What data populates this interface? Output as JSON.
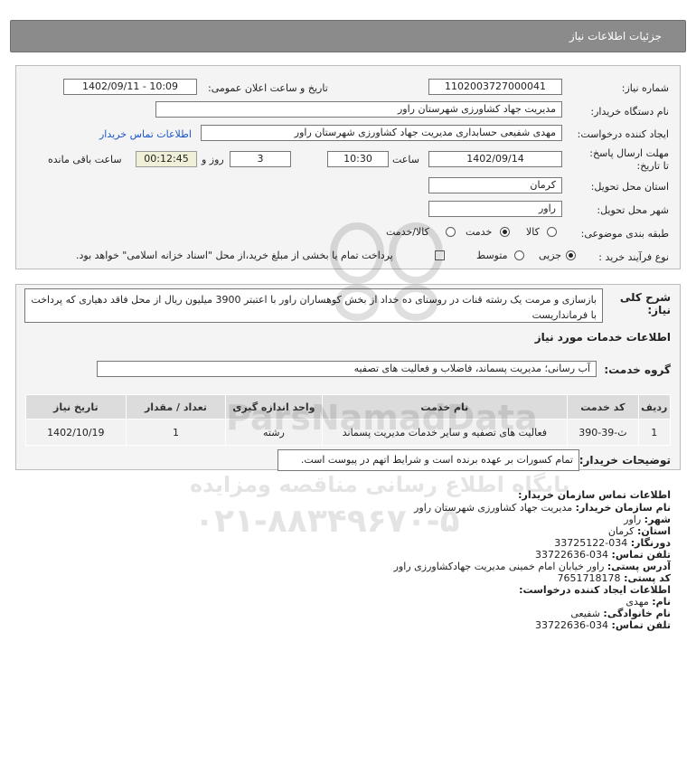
{
  "header": {
    "title": "جزئیات اطلاعات نیاز"
  },
  "form": {
    "need_number_label": "شماره نیاز:",
    "need_number": "1102003727000041",
    "announce_label": "تاریخ و ساعت اعلان عمومی:",
    "announce_value": "1402/09/11 - 10:09",
    "buyer_org_label": "نام دستگاه خریدار:",
    "buyer_org": "مدیریت جهاد کشاورزی شهرستان راور",
    "creator_label": "ایجاد کننده درخواست:",
    "creator": "مهدی شفیعی حسابداری مدیریت جهاد کشاورزی شهرستان راور",
    "contact_link": "اطلاعات تماس خریدار",
    "deadline_label": "مهلت ارسال پاسخ: تا تاریخ:",
    "deadline_date": "1402/09/14",
    "time_label": "ساعت",
    "deadline_time": "10:30",
    "days_value": "3",
    "days_label": "روز و",
    "timer": "00:12:45",
    "remaining_label": "ساعت باقی مانده",
    "province_label": "استان محل تحویل:",
    "province": "کرمان",
    "city_label": "شهر محل تحویل:",
    "city": "راور",
    "category_label": "طبقه بندی موضوعی:",
    "category_options": [
      "کالا",
      "خدمت",
      "کالا/خدمت"
    ],
    "process_label": "نوع فرآیند خرید :",
    "process_options": [
      "جزیی",
      "متوسط"
    ],
    "treasury_note": "پرداخت تمام یا بخشی از مبلغ خرید،از محل \"اسناد خزانه اسلامی\" خواهد بود."
  },
  "summary": {
    "label": "شرح کلی نیاز:",
    "text": "بازسازی و مرمت یک رشته قنات در روستای ده خداد از بخش کوهساران راور با اعتبتر 3900 میلیون ریال از محل فاقد دهیاری که پرداخت با فرمانداریست"
  },
  "services": {
    "section_title": "اطلاعات خدمات مورد نیاز",
    "group_label": "گروه خدمت:",
    "group_value": "آب رسانی؛ مدیریت پسماند، فاضلاب و فعالیت های تصفیه",
    "columns": [
      "ردیف",
      "کد خدمت",
      "نام خدمت",
      "واحد اندازه گیری",
      "تعداد / مقدار",
      "تاریخ نیاز"
    ],
    "rows": [
      {
        "row": "1",
        "code": "ث-39-390",
        "name": "فعالیت های تصفیه و سایر خدمات مدیریت پسماند",
        "unit": "رشته",
        "qty": "1",
        "date": "1402/10/19"
      }
    ]
  },
  "buyer_notes": {
    "label": "توضیحات خریدار:",
    "text": "تمام کسورات بر عهده برنده است و شرایط اتهم در پیوست است."
  },
  "contact_info": {
    "title": "اطلاعات تماس سازمان خریدار:",
    "org_label": "نام سازمان خریدار:",
    "org": "مدیریت جهاد کشاورزی شهرستان راور",
    "city_label": "شهر:",
    "city": "راور",
    "province_label": "استان:",
    "province": "کرمان",
    "fax_label": "دورنگار:",
    "fax": "034-33725122",
    "phone_label": "تلفن تماس:",
    "phone": "034-33722636",
    "address_label": "آدرس پستی:",
    "address": "راور خیابان امام خمینی مدیریت جهادکشاورزی راور",
    "postal_label": "کد پستی:",
    "postal": "7651718178",
    "creator_title": "اطلاعات ایجاد کننده درخواست:",
    "first_name_label": "نام:",
    "first_name": "مهدی",
    "last_name_label": "نام خانوادگی:",
    "last_name": "شفیعی",
    "creator_phone_label": "تلفن تماس:",
    "creator_phone": "034-33722636"
  },
  "watermark": {
    "brand": "ParsNamadData",
    "line1": "پایگاه اطلاع رسانی مناقصه ومزایده",
    "phone": "۰۲۱-۸۸۳۴۹۶۷۰-۵"
  }
}
